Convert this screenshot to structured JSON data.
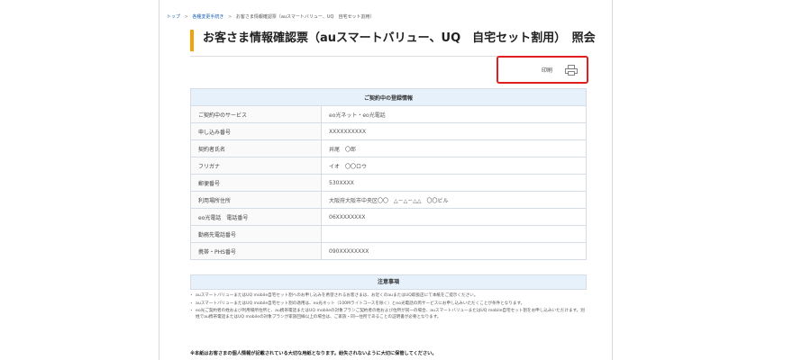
{
  "breadcrumb": {
    "top": "トップ",
    "procedures": "各種変更手続き",
    "current": "お客さま情報確認票（auスマートバリュー、UQ　自宅セット割用）"
  },
  "page_title": "お客さま情報確認票（auスマートバリュー、UQ　自宅セット割用）　照会",
  "print": {
    "label": "印刷",
    "icon": "printer-icon"
  },
  "registration": {
    "heading": "ご契約中の登録情報",
    "rows": [
      {
        "label": "ご契約中のサービス",
        "value": "eo光ネット・eo光電話"
      },
      {
        "label": "申し込み番号",
        "value": "XXXXXXXXXX"
      },
      {
        "label": "契約者氏名",
        "value": "井尾　〇郎"
      },
      {
        "label": "フリガナ",
        "value": "イオ　〇〇ロウ"
      },
      {
        "label": "郵便番号",
        "value": "530XXXX"
      },
      {
        "label": "利用場所住所",
        "value": "大阪府大阪市中央区〇〇　△－△－△△　〇〇ビル"
      },
      {
        "label": "eo光電話　電話番号",
        "value": "06XXXXXXXX"
      },
      {
        "label": "勤務先電話番号",
        "value": ""
      },
      {
        "label": "携帯・PHS番号",
        "value": "090XXXXXXXX"
      }
    ]
  },
  "notes": {
    "heading": "注意事項",
    "items": [
      "auスマートバリューまたはUQ mobile自宅セット割へのお申し込みを希望されるお客さまは、お近くのauまたはUQ取扱店にて本紙をご提示ください。",
      "auスマートバリューまたはUQ mobile自宅セット割の適用は、eo光ネット（100Mライトコースを除く）とeo光電話の両サービスにお申し込みいただくことが条件となります。",
      "eo光ご契約者の姓および利用場所住所と、au携帯電話またはUQ mobileの対象プランご契約者の姓および住所が同一の場合、auスマートバリューまたはUQ mobile自宅セット割をお申し込みいただけます。別姓でau携帯電話またはUQ mobileの対象プランが家族回線以上の場合は、ご家族・同一住所であることの証明書が必要となります。"
    ],
    "warning": "※本紙はお客さまの個人情報が記載されている大切な用紙となります。紛失されないように大切に保管してください。"
  }
}
